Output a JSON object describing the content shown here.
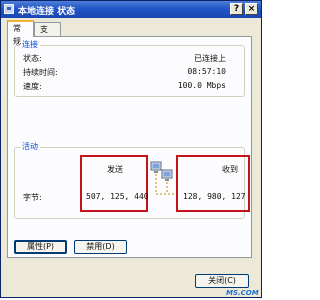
{
  "window": {
    "title": "本地连接 状态",
    "help_glyph": "?",
    "close_glyph": "×"
  },
  "tabs": [
    {
      "label": "常规"
    },
    {
      "label": "支持"
    }
  ],
  "connection": {
    "group_label": "连接",
    "rows": [
      {
        "label": "状态:",
        "value": "已连接上"
      },
      {
        "label": "持续时间:",
        "value": "08:57:10"
      },
      {
        "label": "速度:",
        "value": "100.0 Mbps"
      }
    ]
  },
  "activity": {
    "group_label": "活动",
    "sent_label": "发送",
    "received_label": "收到",
    "bytes_label": "字节:",
    "bytes_sent": "507, 125, 440",
    "bytes_received": "128, 980, 127",
    "highlight_color": "#c4121b"
  },
  "buttons": {
    "properties": "属性(P)",
    "disable": "禁用(D)",
    "close": "关闭(C)"
  },
  "watermark": "MS.COM"
}
